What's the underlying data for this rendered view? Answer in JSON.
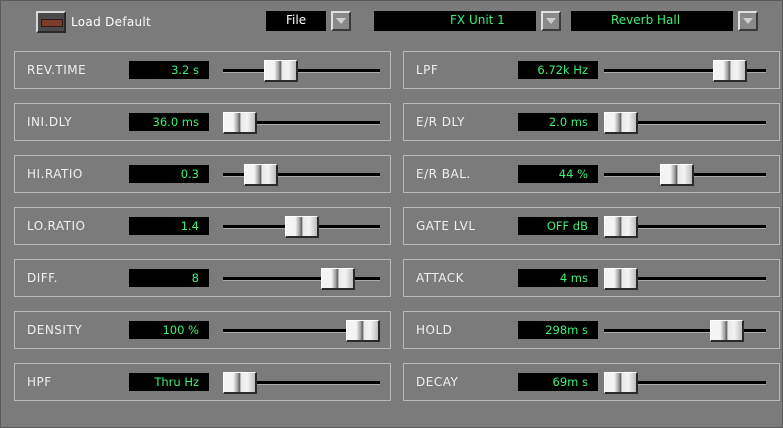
{
  "header": {
    "load_default_label": "Load Default",
    "file_label": "File",
    "unit_label": "FX Unit 1",
    "program_label": "Reverb Hall"
  },
  "left_params": [
    {
      "label": "REV.TIME",
      "value": "3.2 s",
      "position": 0.33
    },
    {
      "label": "INI.DLY",
      "value": "36.0 ms",
      "position": 0.0
    },
    {
      "label": "HI.RATIO",
      "value": "0.3",
      "position": 0.17
    },
    {
      "label": "LO.RATIO",
      "value": "1.4",
      "position": 0.5
    },
    {
      "label": "DIFF.",
      "value": "8",
      "position": 0.8
    },
    {
      "label": "DENSITY",
      "value": "100 %",
      "position": 1.0
    },
    {
      "label": "HPF",
      "value": "Thru Hz",
      "position": 0.0
    }
  ],
  "right_params": [
    {
      "label": "LPF",
      "value": "6.72k Hz",
      "position": 0.85
    },
    {
      "label": "E/R DLY",
      "value": "2.0 ms",
      "position": 0.0
    },
    {
      "label": "E/R BAL.",
      "value": "44 %",
      "position": 0.44
    },
    {
      "label": "GATE LVL",
      "value": "OFF dB",
      "position": 0.0
    },
    {
      "label": "ATTACK",
      "value": "4 ms",
      "position": 0.0
    },
    {
      "label": "HOLD",
      "value": "298m s",
      "position": 0.83
    },
    {
      "label": "DECAY",
      "value": "69m s",
      "position": 0.0
    }
  ]
}
